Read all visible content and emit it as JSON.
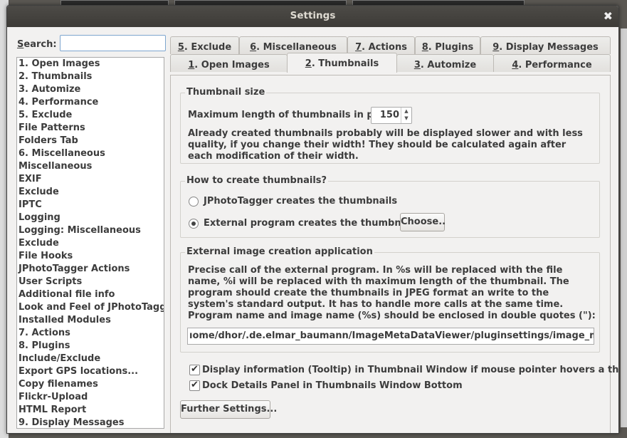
{
  "window": {
    "title": "Settings",
    "close_glyph": "✖"
  },
  "search": {
    "label_mnemonic": "S",
    "label_rest": "earch:",
    "value": ""
  },
  "nav": {
    "items": [
      "1. Open Images",
      "2. Thumbnails",
      "3. Automize",
      "4. Performance",
      "5. Exclude",
      "File Patterns",
      "Folders Tab",
      "6. Miscellaneous",
      "Miscellaneous",
      "EXIF",
      "Exclude",
      "IPTC",
      "Logging",
      "Logging: Miscellaneous",
      "Exclude",
      "File Hooks",
      "JPhotoTagger Actions",
      "User Scripts",
      "Additional file info",
      "Look and Feel of JPhotoTagger",
      "Installed Modules",
      "7. Actions",
      "8. Plugins",
      "Include/Exclude",
      "Export GPS locations...",
      "Copy filenames",
      "Flickr-Upload",
      "HTML Report",
      "9. Display Messages"
    ]
  },
  "tabs": {
    "row1": [
      {
        "num": "5",
        "rest": ". Exclude"
      },
      {
        "num": "6",
        "rest": ". Miscellaneous"
      },
      {
        "num": "7",
        "rest": ". Actions"
      },
      {
        "num": "8",
        "rest": ". Plugins"
      },
      {
        "num": "9",
        "rest": ". Display Messages"
      }
    ],
    "row2": [
      {
        "num": "1",
        "rest": ". Open Images"
      },
      {
        "num": "2",
        "rest": ". Thumbnails"
      },
      {
        "num": "3",
        "rest": ". Automize"
      },
      {
        "num": "4",
        "rest": ". Performance"
      }
    ],
    "active": "2. Thumbnails"
  },
  "thumbnail_size": {
    "title": "Thumbnail size",
    "max_length_label": "Maximum length of thumbnails in pixel:",
    "max_length_value": "150",
    "note": "Already created thumbnails probably will be displayed slower and with less quality, if you change their width! They should be calculated again after each modification of their width."
  },
  "how_to_create": {
    "title": "How to create thumbnails?",
    "option_internal": "JPhotoTagger creates the thumbnails",
    "option_external": "External program creates the thumbnails",
    "selected": "external",
    "choose_label": "Choose.."
  },
  "external_app": {
    "title": "External image creation application",
    "description": "Precise call of the external program. In %s will be replaced with the file name, %i will be replaced with th maximum length of the thumbnail. The program should create the thumbnails in JPEG format an write to the system's standard output. It has to handle more calls at the same time. Program name and image name (%s) should be enclosed in double quotes (\"):",
    "command": "ıome/dhor/.de.elmar_baumann/ImageMetaDataViewer/pluginsettings/image_magick_c"
  },
  "options": {
    "tooltip_label": "Display information (Tooltip) in Thumbnail Window if mouse pointer hovers a thumbnail",
    "tooltip_checked": true,
    "dock_label": "Dock Details Panel in Thumbnails Window Bottom",
    "dock_checked": true
  },
  "further_settings_label": "Further Settings..."
}
